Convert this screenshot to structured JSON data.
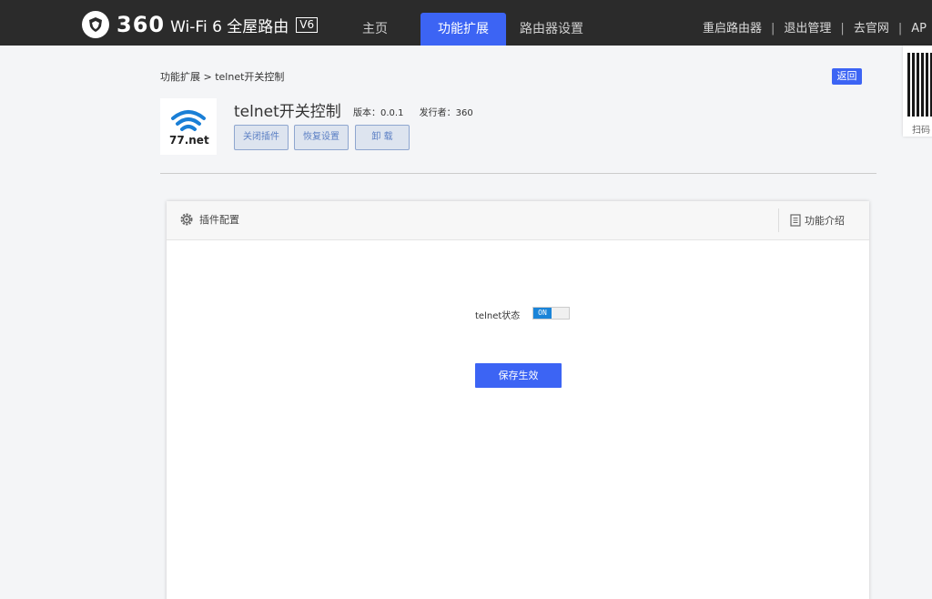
{
  "header": {
    "logo_number": "360",
    "logo_text": "Wi-Fi 6 全屋路由",
    "logo_version": "V6",
    "tabs": [
      {
        "label": "主页"
      },
      {
        "label": "功能扩展"
      },
      {
        "label": "路由器设置"
      }
    ],
    "right_links": [
      {
        "label": "重启路由器"
      },
      {
        "label": "退出管理"
      },
      {
        "label": "去官网"
      },
      {
        "label": "AP"
      }
    ],
    "separator": "|"
  },
  "side": {
    "qr_label": "扫码"
  },
  "breadcrumb": "功能扩展 > telnet开关控制",
  "back_label": "返回",
  "plugin": {
    "icon_text": "77.net",
    "title": "telnet开关控制",
    "version": "版本：0.0.1",
    "publisher": "发行者：360",
    "buttons": [
      {
        "label": "关闭插件"
      },
      {
        "label": "恢复设置"
      },
      {
        "label": "卸 载"
      }
    ]
  },
  "panel": {
    "config_label": "插件配置",
    "intro_label": "功能介绍",
    "telnet_label": "telnet状态",
    "toggle_text": "ON",
    "save_label": "保存生效"
  },
  "colors": {
    "accent": "#3c64f4",
    "topbar": "#2b2b2b",
    "toggle_on": "#1a84d8"
  }
}
